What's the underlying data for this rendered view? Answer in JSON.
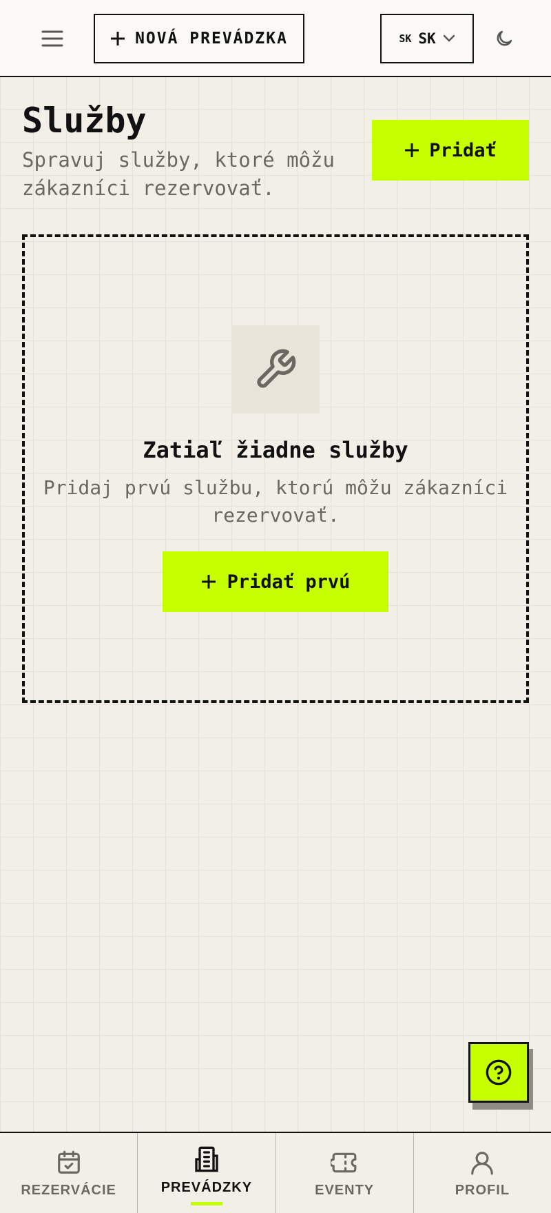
{
  "header": {
    "new_venue_label": "NOVÁ PREVÁDZKA",
    "lang_flag": "SK",
    "lang_code": "SK"
  },
  "page": {
    "title": "Služby",
    "subtitle": "Spravuj služby, ktoré môžu zákazníci rezervovať.",
    "add_label": "Pridať"
  },
  "empty_state": {
    "icon": "wrench-icon",
    "title": "Zatiaľ žiadne služby",
    "description": "Pridaj prvú službu, ktorú môžu zákazníci rezervovať.",
    "button_label": "Pridať prvú"
  },
  "bottom_nav": {
    "items": [
      {
        "label": "REZERVÁCIE",
        "icon": "calendar-check-icon",
        "active": false
      },
      {
        "label": "PREVÁDZKY",
        "icon": "building-icon",
        "active": true
      },
      {
        "label": "EVENTY",
        "icon": "ticket-icon",
        "active": false
      },
      {
        "label": "PROFIL",
        "icon": "user-icon",
        "active": false
      }
    ]
  },
  "colors": {
    "accent": "#c6ff00",
    "background": "#f2efe8",
    "text": "#111111",
    "muted": "#6b6861"
  }
}
